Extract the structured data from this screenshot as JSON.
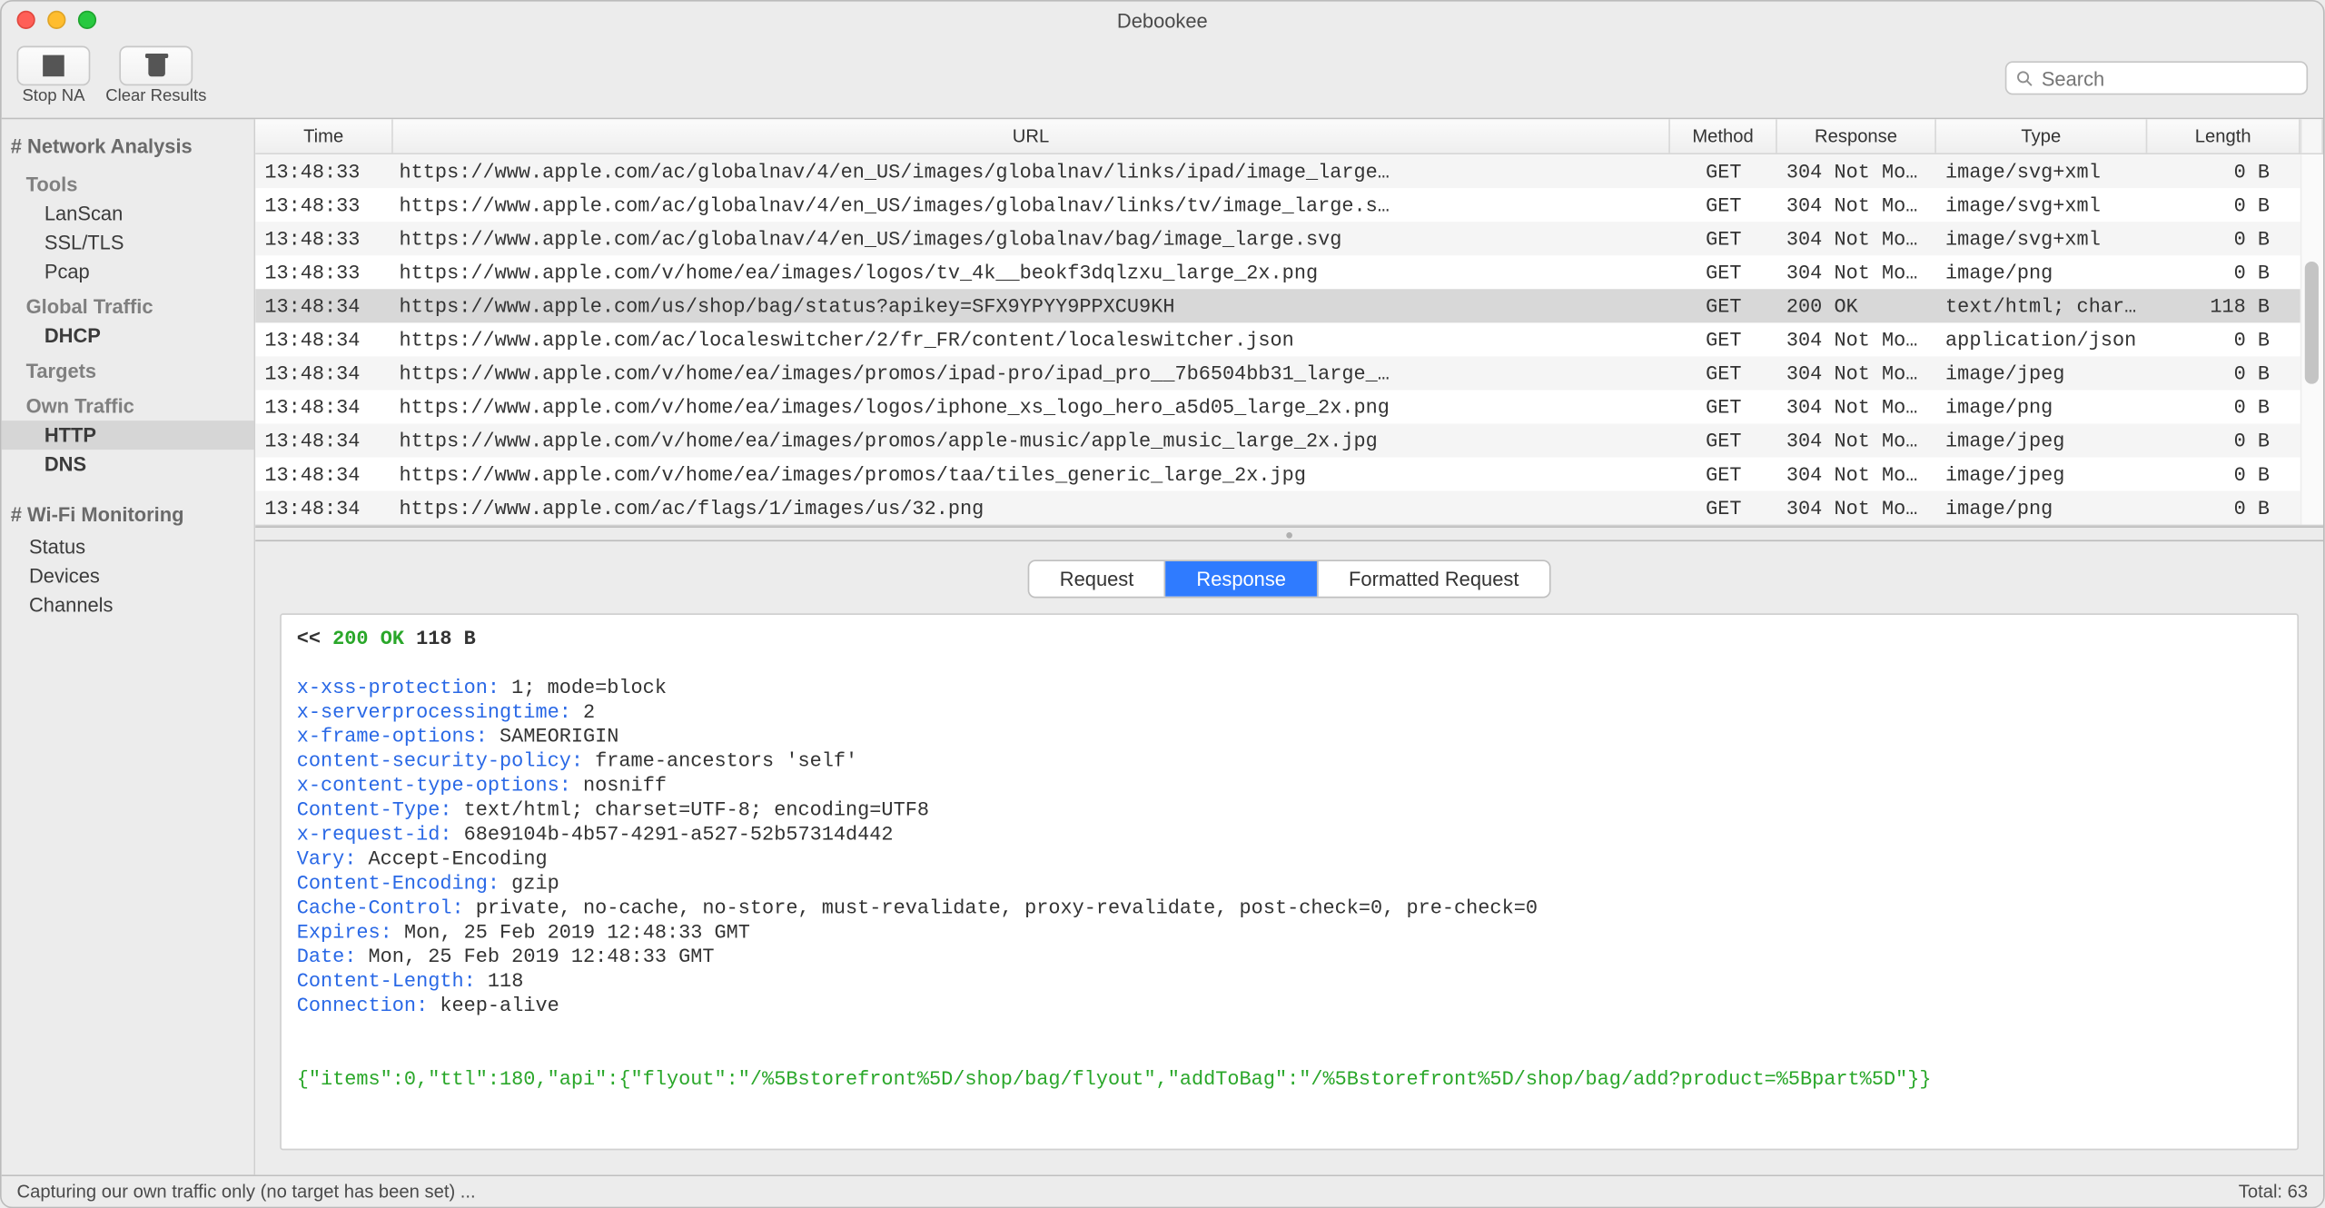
{
  "window": {
    "title": "Debookee"
  },
  "toolbar": {
    "stop_label": "Stop NA",
    "clear_label": "Clear Results",
    "search_placeholder": "Search"
  },
  "sidebar": {
    "section1_header": "# Network Analysis",
    "tools_label": "Tools",
    "tools": [
      "LanScan",
      "SSL/TLS",
      "Pcap"
    ],
    "global_label": "Global Traffic",
    "global": [
      {
        "label": "DHCP",
        "bold": true
      }
    ],
    "targets_label": "Targets",
    "own_label": "Own Traffic",
    "own": [
      {
        "label": "HTTP",
        "bold": true,
        "selected": true
      },
      {
        "label": "DNS",
        "bold": true
      }
    ],
    "section2_header": "# Wi-Fi Monitoring",
    "wifi": [
      "Status",
      "Devices",
      "Channels"
    ]
  },
  "table": {
    "columns": {
      "time": "Time",
      "url": "URL",
      "method": "Method",
      "response": "Response",
      "type": "Type",
      "length": "Length"
    },
    "rows": [
      {
        "time": "13:48:33",
        "url": "https://www.apple.com/ac/globalnav/4/en_US/images/globalnav/links/ipad/image_large…",
        "method": "GET",
        "response": "304 Not Mod…",
        "type": "image/svg+xml",
        "length": "0 B"
      },
      {
        "time": "13:48:33",
        "url": "https://www.apple.com/ac/globalnav/4/en_US/images/globalnav/links/tv/image_large.s…",
        "method": "GET",
        "response": "304 Not Mod…",
        "type": "image/svg+xml",
        "length": "0 B"
      },
      {
        "time": "13:48:33",
        "url": "https://www.apple.com/ac/globalnav/4/en_US/images/globalnav/bag/image_large.svg",
        "method": "GET",
        "response": "304 Not Mod…",
        "type": "image/svg+xml",
        "length": "0 B"
      },
      {
        "time": "13:48:33",
        "url": "https://www.apple.com/v/home/ea/images/logos/tv_4k__beokf3dqlzxu_large_2x.png",
        "method": "GET",
        "response": "304 Not Mod…",
        "type": "image/png",
        "length": "0 B"
      },
      {
        "time": "13:48:34",
        "url": "https://www.apple.com/us/shop/bag/status?apikey=SFX9YPYY9PPXCU9KH",
        "method": "GET",
        "response": "200 OK",
        "type": "text/html; char…",
        "length": "118 B",
        "selected": true
      },
      {
        "time": "13:48:34",
        "url": "https://www.apple.com/ac/localeswitcher/2/fr_FR/content/localeswitcher.json",
        "method": "GET",
        "response": "304 Not Mod…",
        "type": "application/json",
        "length": "0 B"
      },
      {
        "time": "13:48:34",
        "url": "https://www.apple.com/v/home/ea/images/promos/ipad-pro/ipad_pro__7b6504bb31_large_…",
        "method": "GET",
        "response": "304 Not Mod…",
        "type": "image/jpeg",
        "length": "0 B"
      },
      {
        "time": "13:48:34",
        "url": "https://www.apple.com/v/home/ea/images/logos/iphone_xs_logo_hero_a5d05_large_2x.png",
        "method": "GET",
        "response": "304 Not Mod…",
        "type": "image/png",
        "length": "0 B"
      },
      {
        "time": "13:48:34",
        "url": "https://www.apple.com/v/home/ea/images/promos/apple-music/apple_music_large_2x.jpg",
        "method": "GET",
        "response": "304 Not Mod…",
        "type": "image/jpeg",
        "length": "0 B"
      },
      {
        "time": "13:48:34",
        "url": "https://www.apple.com/v/home/ea/images/promos/taa/tiles_generic_large_2x.jpg",
        "method": "GET",
        "response": "304 Not Mod…",
        "type": "image/jpeg",
        "length": "0 B"
      },
      {
        "time": "13:48:34",
        "url": "https://www.apple.com/ac/flags/1/images/us/32.png",
        "method": "GET",
        "response": "304 Not Mod…",
        "type": "image/png",
        "length": "0 B"
      }
    ]
  },
  "detail": {
    "tabs": {
      "request": "Request",
      "response": "Response",
      "formatted": "Formatted Request"
    },
    "active_tab": "response",
    "status_prefix": "<<",
    "status_code": "200 OK",
    "status_size": "118 B",
    "headers": [
      {
        "k": "x-xss-protection",
        "v": "1; mode=block"
      },
      {
        "k": "x-serverprocessingtime",
        "v": "2"
      },
      {
        "k": "x-frame-options",
        "v": "SAMEORIGIN"
      },
      {
        "k": "content-security-policy",
        "v": "frame-ancestors 'self'"
      },
      {
        "k": "x-content-type-options",
        "v": "nosniff"
      },
      {
        "k": "Content-Type",
        "v": "text/html; charset=UTF-8; encoding=UTF8"
      },
      {
        "k": "x-request-id",
        "v": "68e9104b-4b57-4291-a527-52b57314d442"
      },
      {
        "k": "Vary",
        "v": "Accept-Encoding"
      },
      {
        "k": "Content-Encoding",
        "v": "gzip"
      },
      {
        "k": "Cache-Control",
        "v": "private, no-cache, no-store, must-revalidate, proxy-revalidate, post-check=0, pre-check=0"
      },
      {
        "k": "Expires",
        "v": "Mon, 25 Feb 2019 12:48:33 GMT"
      },
      {
        "k": "Date",
        "v": "Mon, 25 Feb 2019 12:48:33 GMT"
      },
      {
        "k": "Content-Length",
        "v": "118"
      },
      {
        "k": "Connection",
        "v": "keep-alive"
      }
    ],
    "body": "{\"items\":0,\"ttl\":180,\"api\":{\"flyout\":\"/%5Bstorefront%5D/shop/bag/flyout\",\"addToBag\":\"/%5Bstorefront%5D/shop/bag/add?product=%5Bpart%5D\"}}"
  },
  "statusbar": {
    "left": "Capturing our own traffic only (no target has been set) ...",
    "right": "Total: 63"
  }
}
